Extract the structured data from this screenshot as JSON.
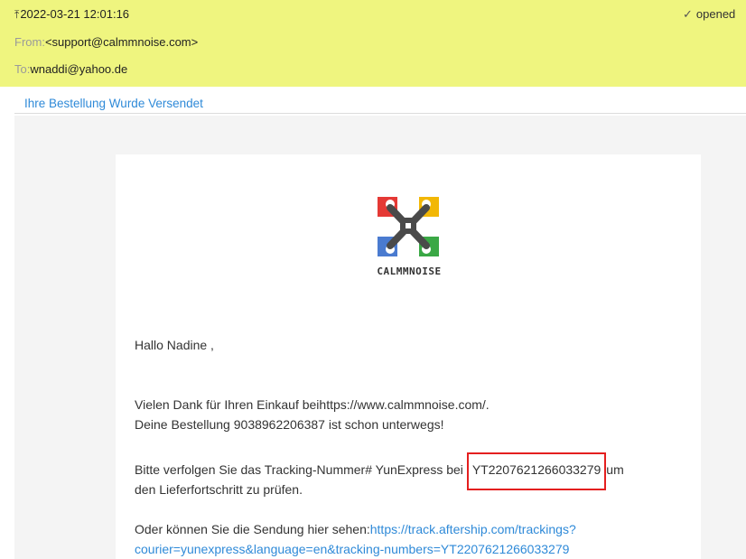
{
  "header": {
    "datetime": "2022-03-21 12:01:16",
    "status": "opened",
    "from_label": "From:",
    "from_value": "<support@calmmnoise.com>",
    "to_label": "To:",
    "to_value": "wnaddi@yahoo.de",
    "bg_color": "#eff57f"
  },
  "subject": "Ihre Bestellung Wurde Versendet",
  "logo": {
    "text": "CALMMNOISE",
    "colors": {
      "red": "#e53935",
      "yellow": "#f2b705",
      "blue": "#4a7bd0",
      "green": "#3aa845",
      "center": "#4a4a4a"
    }
  },
  "mail": {
    "greeting": "Hallo Nadine ,",
    "thanks_line": "Vielen Dank für Ihren Einkauf beihttps://www.calmmnoise.com/.",
    "order_line_prefix": "Deine Bestellung ",
    "order_number": "9038962206387",
    "order_line_suffix": " ist schon unterwegs!",
    "tracking_prefix": "Bitte verfolgen Sie das Tracking-Nummer# YunExpress bei ",
    "tracking_number": "YT2207621266033279",
    "tracking_suffix": "um",
    "tracking_line2": "den Lieferfortschritt zu prüfen.",
    "alt_prefix": "Oder können Sie die Sendung hier sehen:",
    "alt_link_line1": "https://track.aftership.com/trackings?",
    "alt_link_line2": "courier=yunexpress&language=en&tracking-numbers=YT2207621266033279"
  },
  "accent": {
    "link": "#2f8ad8",
    "highlight_box": "#e41f1f"
  }
}
